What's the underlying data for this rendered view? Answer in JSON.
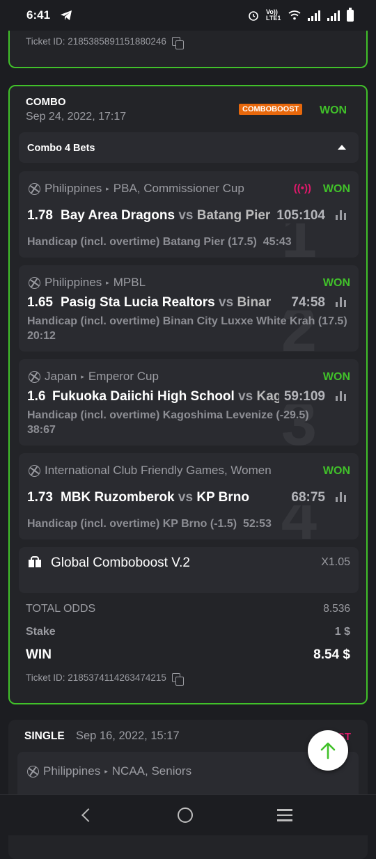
{
  "status_bar": {
    "time": "6:41",
    "network": "Vo)) LTE1"
  },
  "top_card": {
    "ticket_id": "Ticket ID: 2185385891151880246"
  },
  "combo": {
    "label": "COMBO",
    "date": "Sep 24, 2022, 17:17",
    "badge": "COMBOBOOST",
    "status": "WON",
    "header": "Combo 4 Bets",
    "bets": [
      {
        "number": "1",
        "country": "Philippines",
        "league": "PBA, Commissioner Cup",
        "live": "((•))",
        "status": "WON",
        "odds": "1.78",
        "team1": "Bay Area Dragons",
        "vs": "vs",
        "team2": "Batang Pier",
        "score": "105:104",
        "market": "Handicap (incl. overtime) Batang Pier (17.5)",
        "market_score": "45:43"
      },
      {
        "number": "2",
        "country": "Philippines",
        "league": "MPBL",
        "status": "WON",
        "odds": "1.65",
        "team1": "Pasig Sta Lucia Realtors",
        "vs": "vs",
        "team2": "Binan City Luxxe White Krah",
        "score": "74:58",
        "market": "Handicap (incl. overtime) Binan City Luxxe White Krah (17.5)",
        "market_score": "20:12"
      },
      {
        "number": "3",
        "country": "Japan",
        "league": "Emperor Cup",
        "status": "WON",
        "odds": "1.6",
        "team1": "Fukuoka Daiichi High School",
        "vs": "vs",
        "team2": "Kagoshima Levenize",
        "score": "59:109",
        "market": "Handicap (incl. overtime) Kagoshima Levenize (-29.5)",
        "market_score": "38:67"
      },
      {
        "number": "4",
        "country": "International Club Friendly Games, Women",
        "league": "",
        "status": "WON",
        "odds": "1.73",
        "team1": "MBK Ruzomberok",
        "vs": "vs",
        "team2": "KP Brno",
        "score": "68:75",
        "market": "Handicap (incl. overtime) KP Brno (-1.5)",
        "market_score": "52:53"
      }
    ],
    "comboboost": {
      "name": "Global Comboboost V.2",
      "multiplier": "X1.05"
    },
    "total_odds_label": "TOTAL ODDS",
    "total_odds": "8.536",
    "stake_label": "Stake",
    "stake": "1 $",
    "win_label": "WIN",
    "win": "8.54 $",
    "ticket_id": "Ticket ID: 2185374114263474215"
  },
  "single": {
    "label": "SINGLE",
    "date": "Sep 16, 2022, 15:17",
    "status": "LOST",
    "country": "Philippines",
    "league": "NCAA, Seniors"
  },
  "colors": {
    "won": "#41c12a",
    "badge": "#e8680c",
    "live": "#e0196b",
    "card_border": "#41c12a"
  },
  "icons": [
    "telegram-icon",
    "alarm-icon",
    "wifi-icon",
    "signal-icon",
    "battery-icon",
    "copy-icon",
    "basketball-icon",
    "stats-icon",
    "gift-icon",
    "arrow-up-icon",
    "back-icon",
    "home-icon",
    "menu-icon"
  ]
}
